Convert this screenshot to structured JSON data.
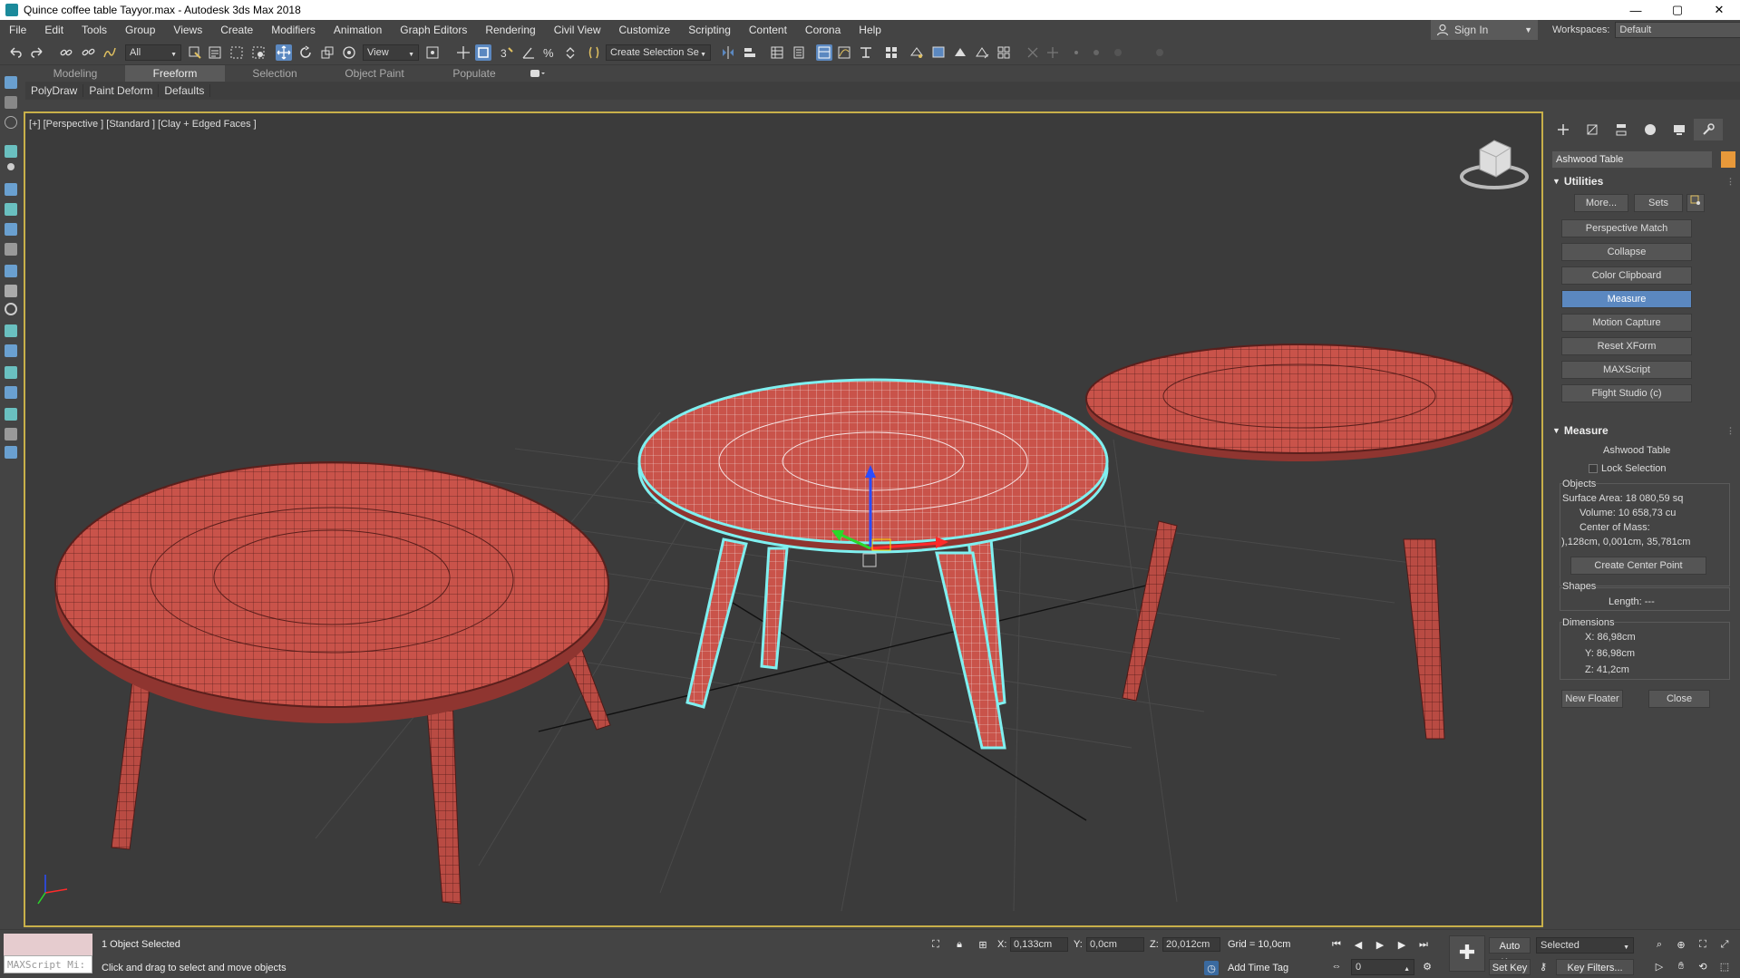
{
  "window": {
    "title": "Quince coffee table Tayyor.max - Autodesk 3ds Max 2018",
    "minimize": "—",
    "maximize": "▢",
    "close": "✕"
  },
  "menu": {
    "items": [
      "File",
      "Edit",
      "Tools",
      "Group",
      "Views",
      "Create",
      "Modifiers",
      "Animation",
      "Graph Editors",
      "Rendering",
      "Civil View",
      "Customize",
      "Scripting",
      "Content",
      "Corona",
      "Help"
    ],
    "signin": "Sign In",
    "workspaces_label": "Workspaces:",
    "workspace_value": "Default"
  },
  "toolbar": {
    "selection_filter": "All",
    "ref_coord": "View",
    "selection_set": "Create Selection Se"
  },
  "ribbon": {
    "tabs": [
      "Modeling",
      "Freeform",
      "Selection",
      "Object Paint",
      "Populate"
    ],
    "active_tab": "Freeform",
    "sub_items": [
      "PolyDraw",
      "Paint Deform",
      "Defaults"
    ]
  },
  "viewport": {
    "label": "[+] [Perspective ] [Standard ] [Clay + Edged Faces ]",
    "table_color": "#c9534a",
    "wire_color": "#5a1f1c",
    "selection_color": "#7ff0f0"
  },
  "command_panel": {
    "object_name": "Ashwood Table",
    "object_color": "#e8993a",
    "utilities": {
      "title": "Utilities",
      "more": "More...",
      "sets": "Sets",
      "buttons": [
        "Perspective Match",
        "Collapse",
        "Color Clipboard",
        "Measure",
        "Motion Capture",
        "Reset XForm",
        "MAXScript",
        "Flight Studio (c)"
      ],
      "active": "Measure"
    },
    "measure": {
      "title": "Measure",
      "object": "Ashwood Table",
      "lock_selection": "Lock Selection",
      "objects_label": "Objects",
      "surface_area": "Surface Area:  18 080,59 sq",
      "volume": "Volume:  10 658,73 cu",
      "center_of_mass": "Center of Mass:",
      "center_value": "),128cm, 0,001cm, 35,781cm",
      "create_center_point": "Create Center Point",
      "shapes_label": "Shapes",
      "length": "Length:  ---",
      "dimensions_label": "Dimensions",
      "x": "X:  86,98cm",
      "y": "Y:  86,98cm",
      "z": "Z:  41,2cm",
      "new_floater": "New Floater",
      "close": "Close"
    }
  },
  "status": {
    "maxscript": "MAXScript Mi:",
    "selected": "1 Object Selected",
    "prompt": "Click and drag to select and move objects",
    "x_label": "X:",
    "x_value": "0,133cm",
    "y_label": "Y:",
    "y_value": "0,0cm",
    "z_label": "Z:",
    "z_value": "20,012cm",
    "grid": "Grid = 10,0cm",
    "add_time_tag": "Add Time Tag",
    "auto_key": "Auto Key",
    "set_key": "Set Key",
    "key_mode": "Selected",
    "frame": "0",
    "key_filters": "Key Filters..."
  }
}
